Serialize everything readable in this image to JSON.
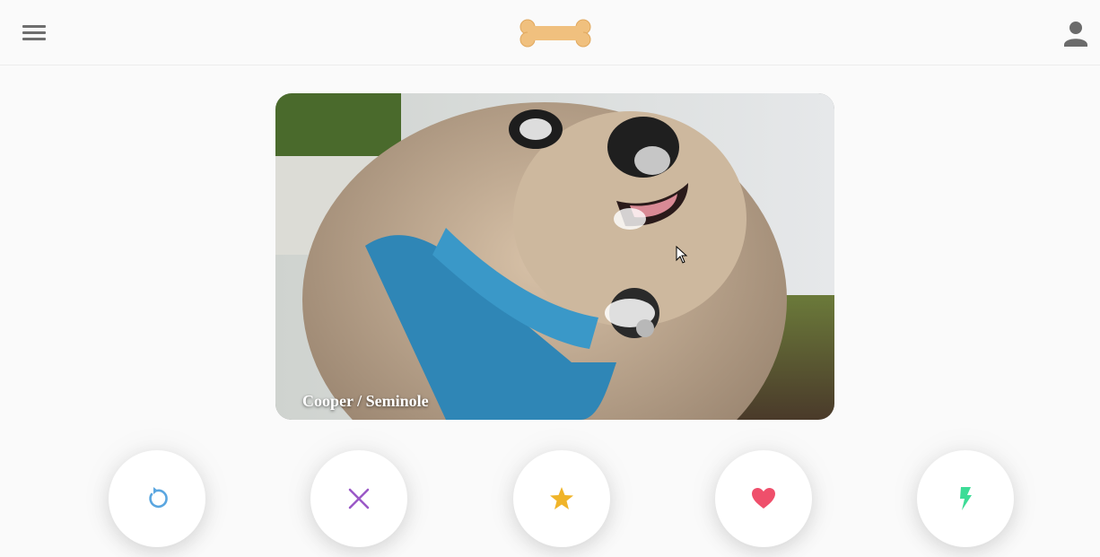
{
  "header": {
    "menu_icon": "hamburger-menu-icon",
    "logo_icon": "bone-logo-icon",
    "profile_icon": "user-profile-icon"
  },
  "card": {
    "caption": "Cooper / Seminole",
    "image": "photo of a tan terrier dog wearing a blue harness"
  },
  "actions": [
    {
      "name": "rewind",
      "icon": "rewind-icon",
      "color": "#5aa6e0"
    },
    {
      "name": "nope",
      "icon": "close-icon",
      "color": "#9b59c7"
    },
    {
      "name": "super-like",
      "icon": "star-icon",
      "color": "#f0b429"
    },
    {
      "name": "like",
      "icon": "heart-icon",
      "color": "#ef4f6b"
    },
    {
      "name": "boost",
      "icon": "lightning-icon",
      "color": "#3ddc97"
    }
  ],
  "colors": {
    "logo": "#f0c07e",
    "background": "#fafafa"
  }
}
